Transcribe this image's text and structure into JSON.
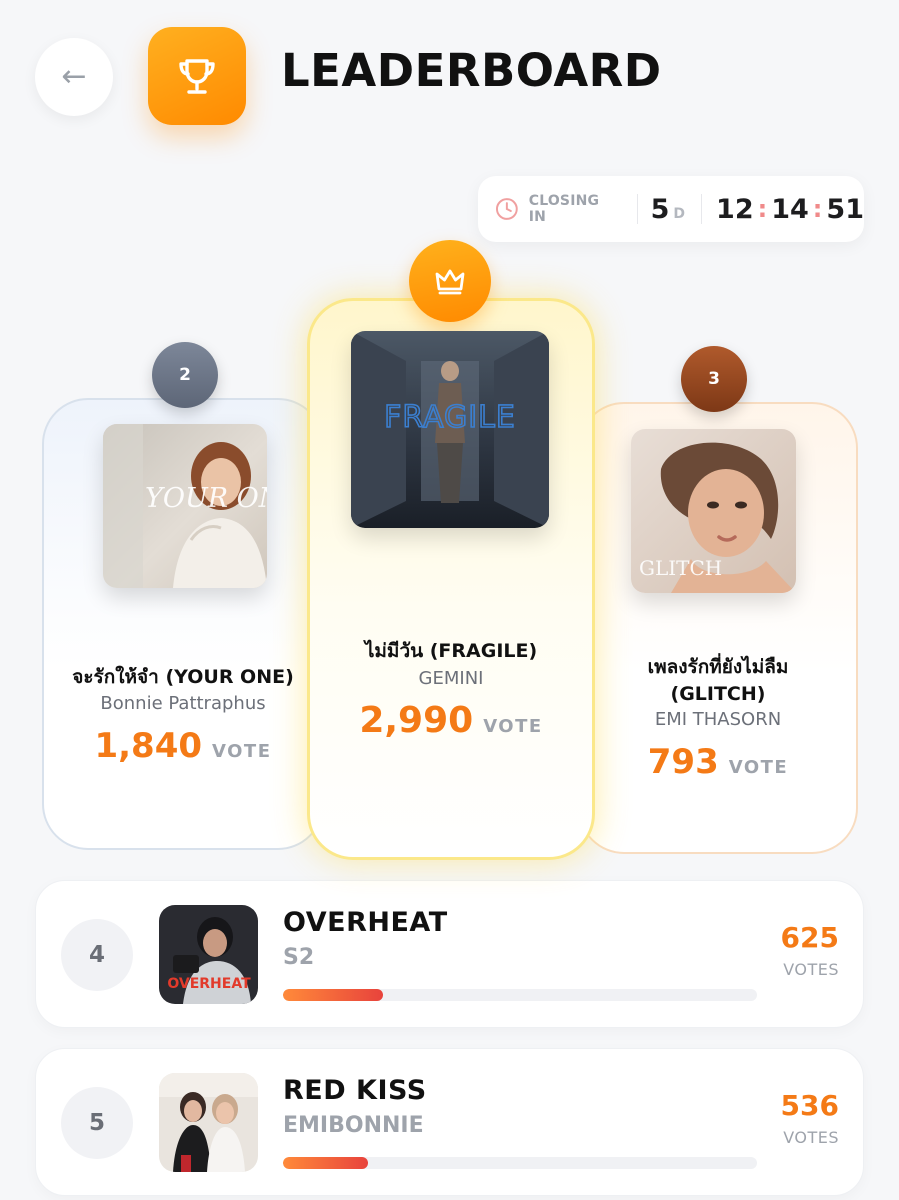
{
  "header": {
    "back_icon": "arrow-left-icon",
    "badge_icon": "trophy-icon",
    "title": "LEADERBOARD"
  },
  "countdown": {
    "icon": "clock-icon",
    "label": "CLOSING IN",
    "days": "5",
    "days_unit": "D",
    "hours": "12",
    "minutes": "14",
    "seconds": "51"
  },
  "podium": [
    {
      "rank": "1",
      "rank_icon": "crown-icon",
      "title": "ไม่มีวัน (FRAGILE)",
      "artist": "GEMINI",
      "votes": "2,990",
      "vote_unit": "VOTE",
      "cover_text": "FRAGILE"
    },
    {
      "rank": "2",
      "title": "จะรักให้จำ (YOUR ONE)",
      "artist": "Bonnie Pattraphus",
      "votes": "1,840",
      "vote_unit": "VOTE",
      "cover_text": "YOUR ONE"
    },
    {
      "rank": "3",
      "title_line1": "เพลงรักที่ยังไม่ลืม",
      "title_line2": "(GLITCH)",
      "artist": "EMI THASORN",
      "votes": "793",
      "vote_unit": "VOTE",
      "cover_text": "GLITCH"
    }
  ],
  "list": [
    {
      "rank": "4",
      "title": "OVERHEAT",
      "artist": "S2",
      "votes": "625",
      "vote_unit": "VOTES",
      "progress": 0.21,
      "cover_text": "OVERHEAT"
    },
    {
      "rank": "5",
      "title": "RED KISS",
      "artist": "EMIBONNIE",
      "votes": "536",
      "vote_unit": "VOTES",
      "progress": 0.18
    }
  ],
  "colors": {
    "accent": "#f47a16",
    "gold": "#ff9a0c",
    "silver": "#6b7485",
    "bronze": "#8f4620"
  }
}
